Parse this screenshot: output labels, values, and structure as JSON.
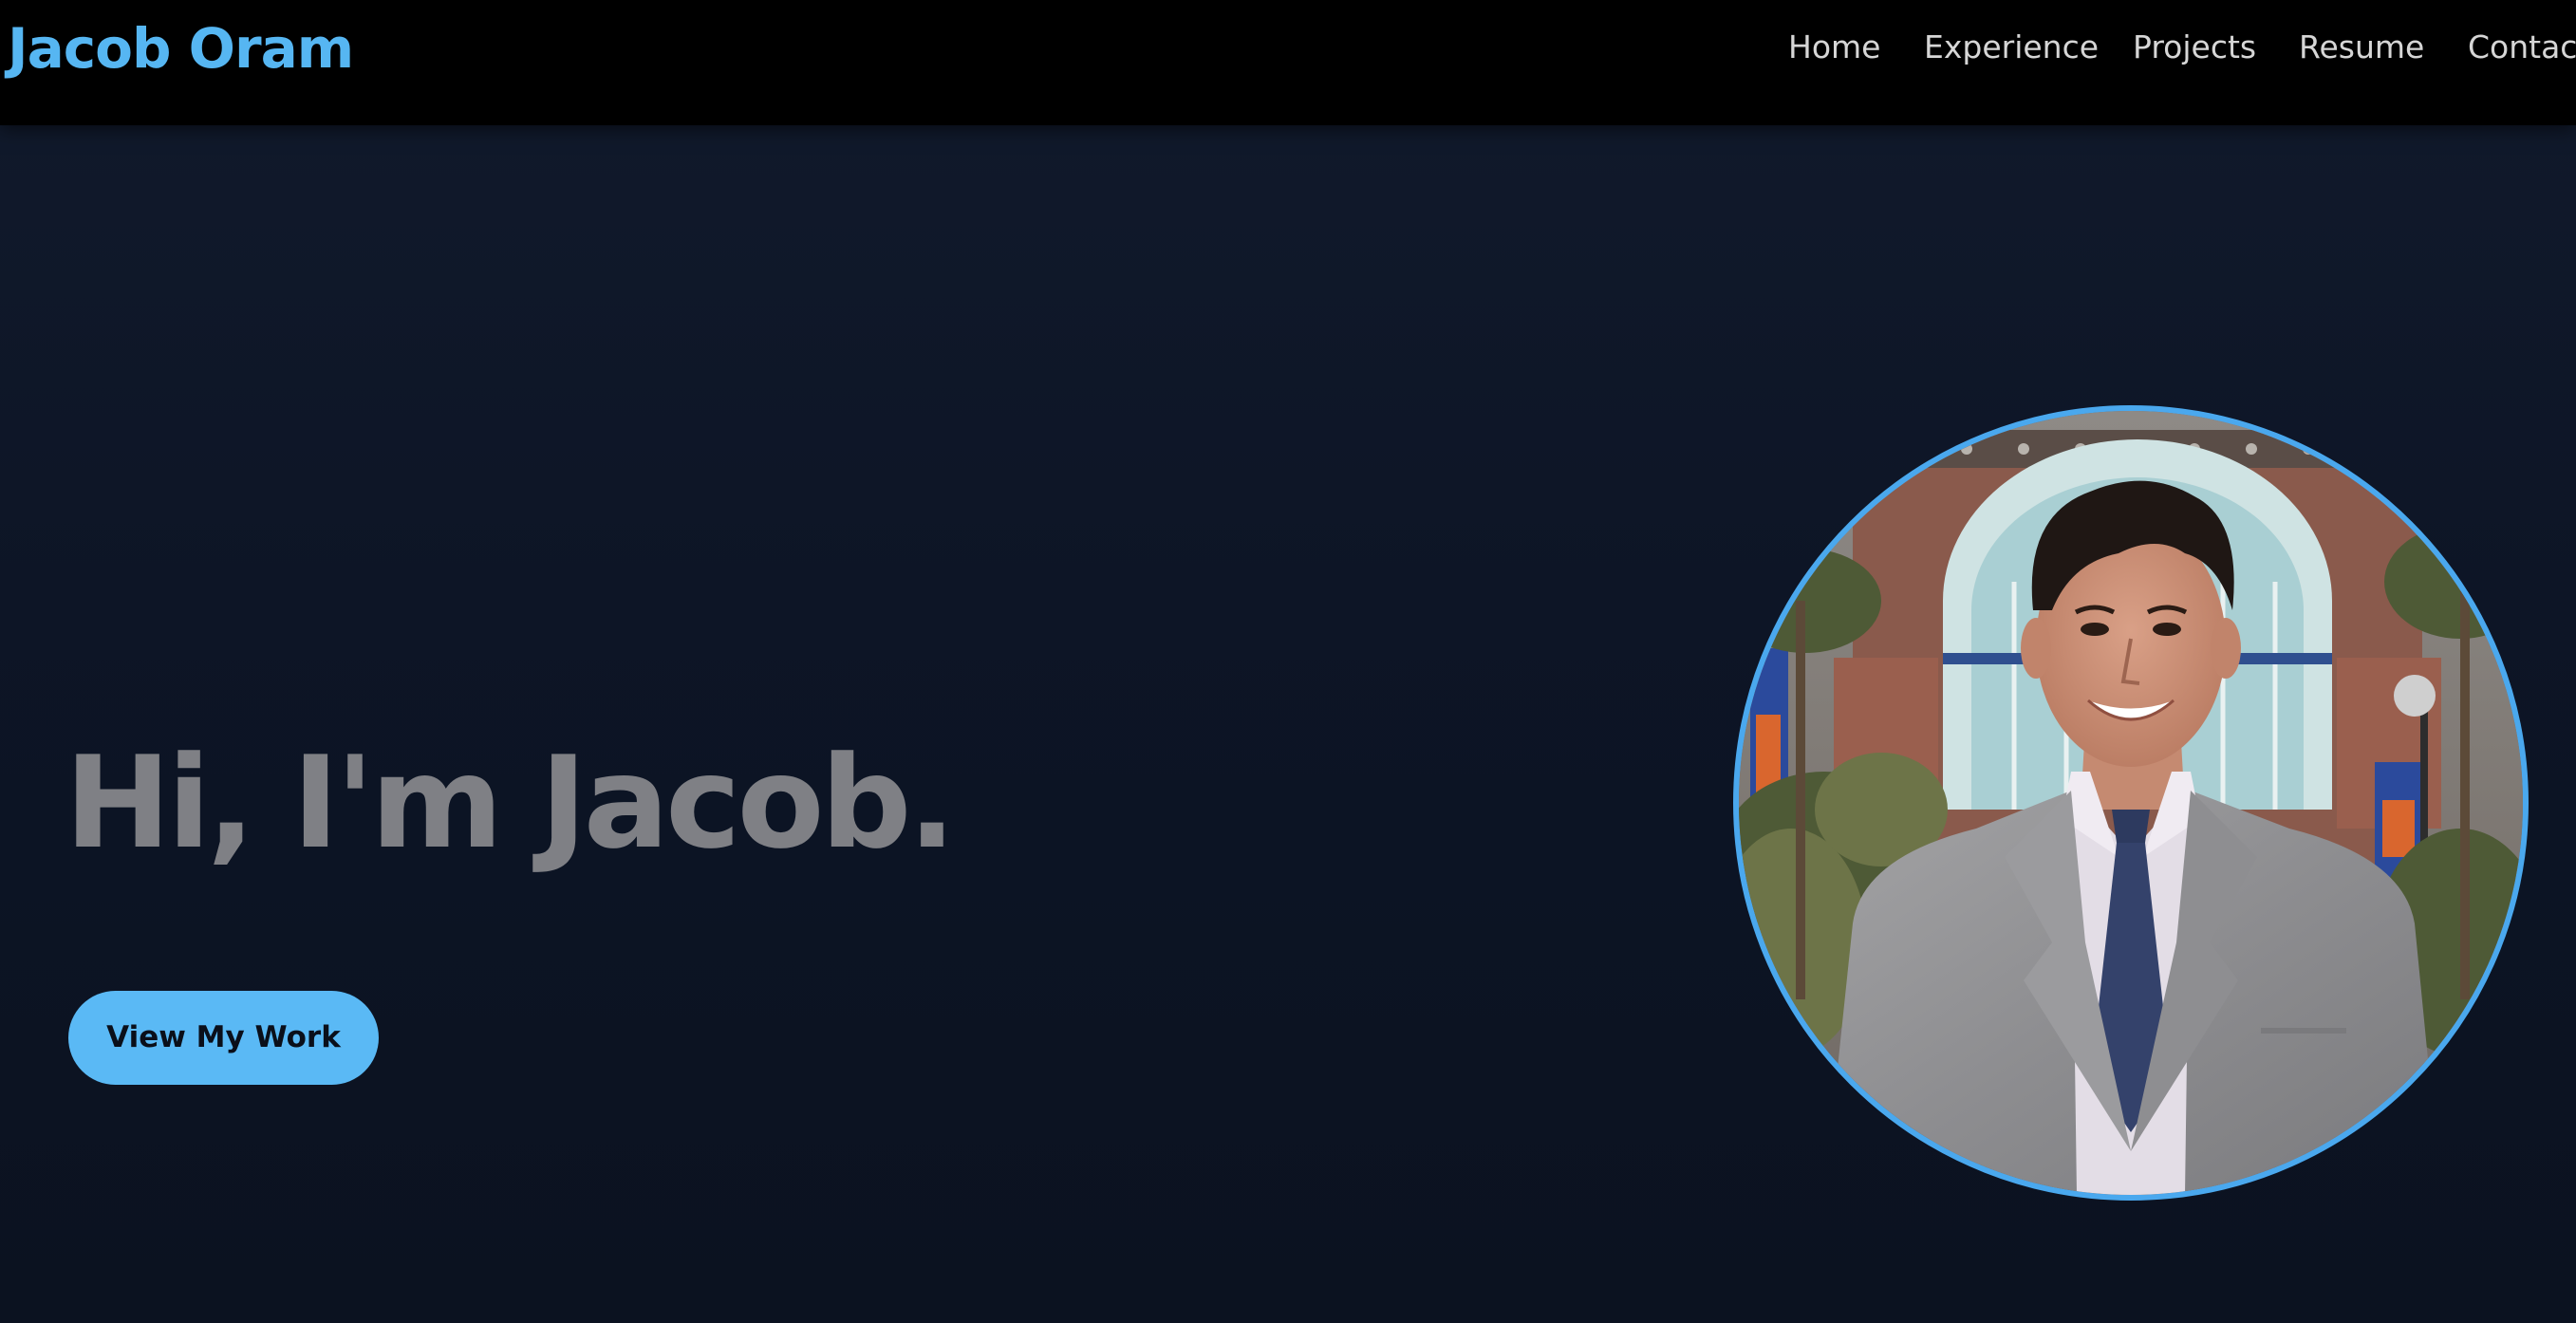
{
  "header": {
    "brand": "Jacob Oram",
    "nav": {
      "home": "Home",
      "experience": "Experience",
      "projects": "Projects",
      "resume": "Resume",
      "contact": "Contac"
    }
  },
  "hero": {
    "title": "Hi, I'm Jacob.",
    "cta_label": "View My Work"
  },
  "colors": {
    "accent": "#56b6f2",
    "button": "#5ab9f5",
    "background": "#0d1526",
    "navbar": "#000000",
    "title": "#7f8085"
  }
}
